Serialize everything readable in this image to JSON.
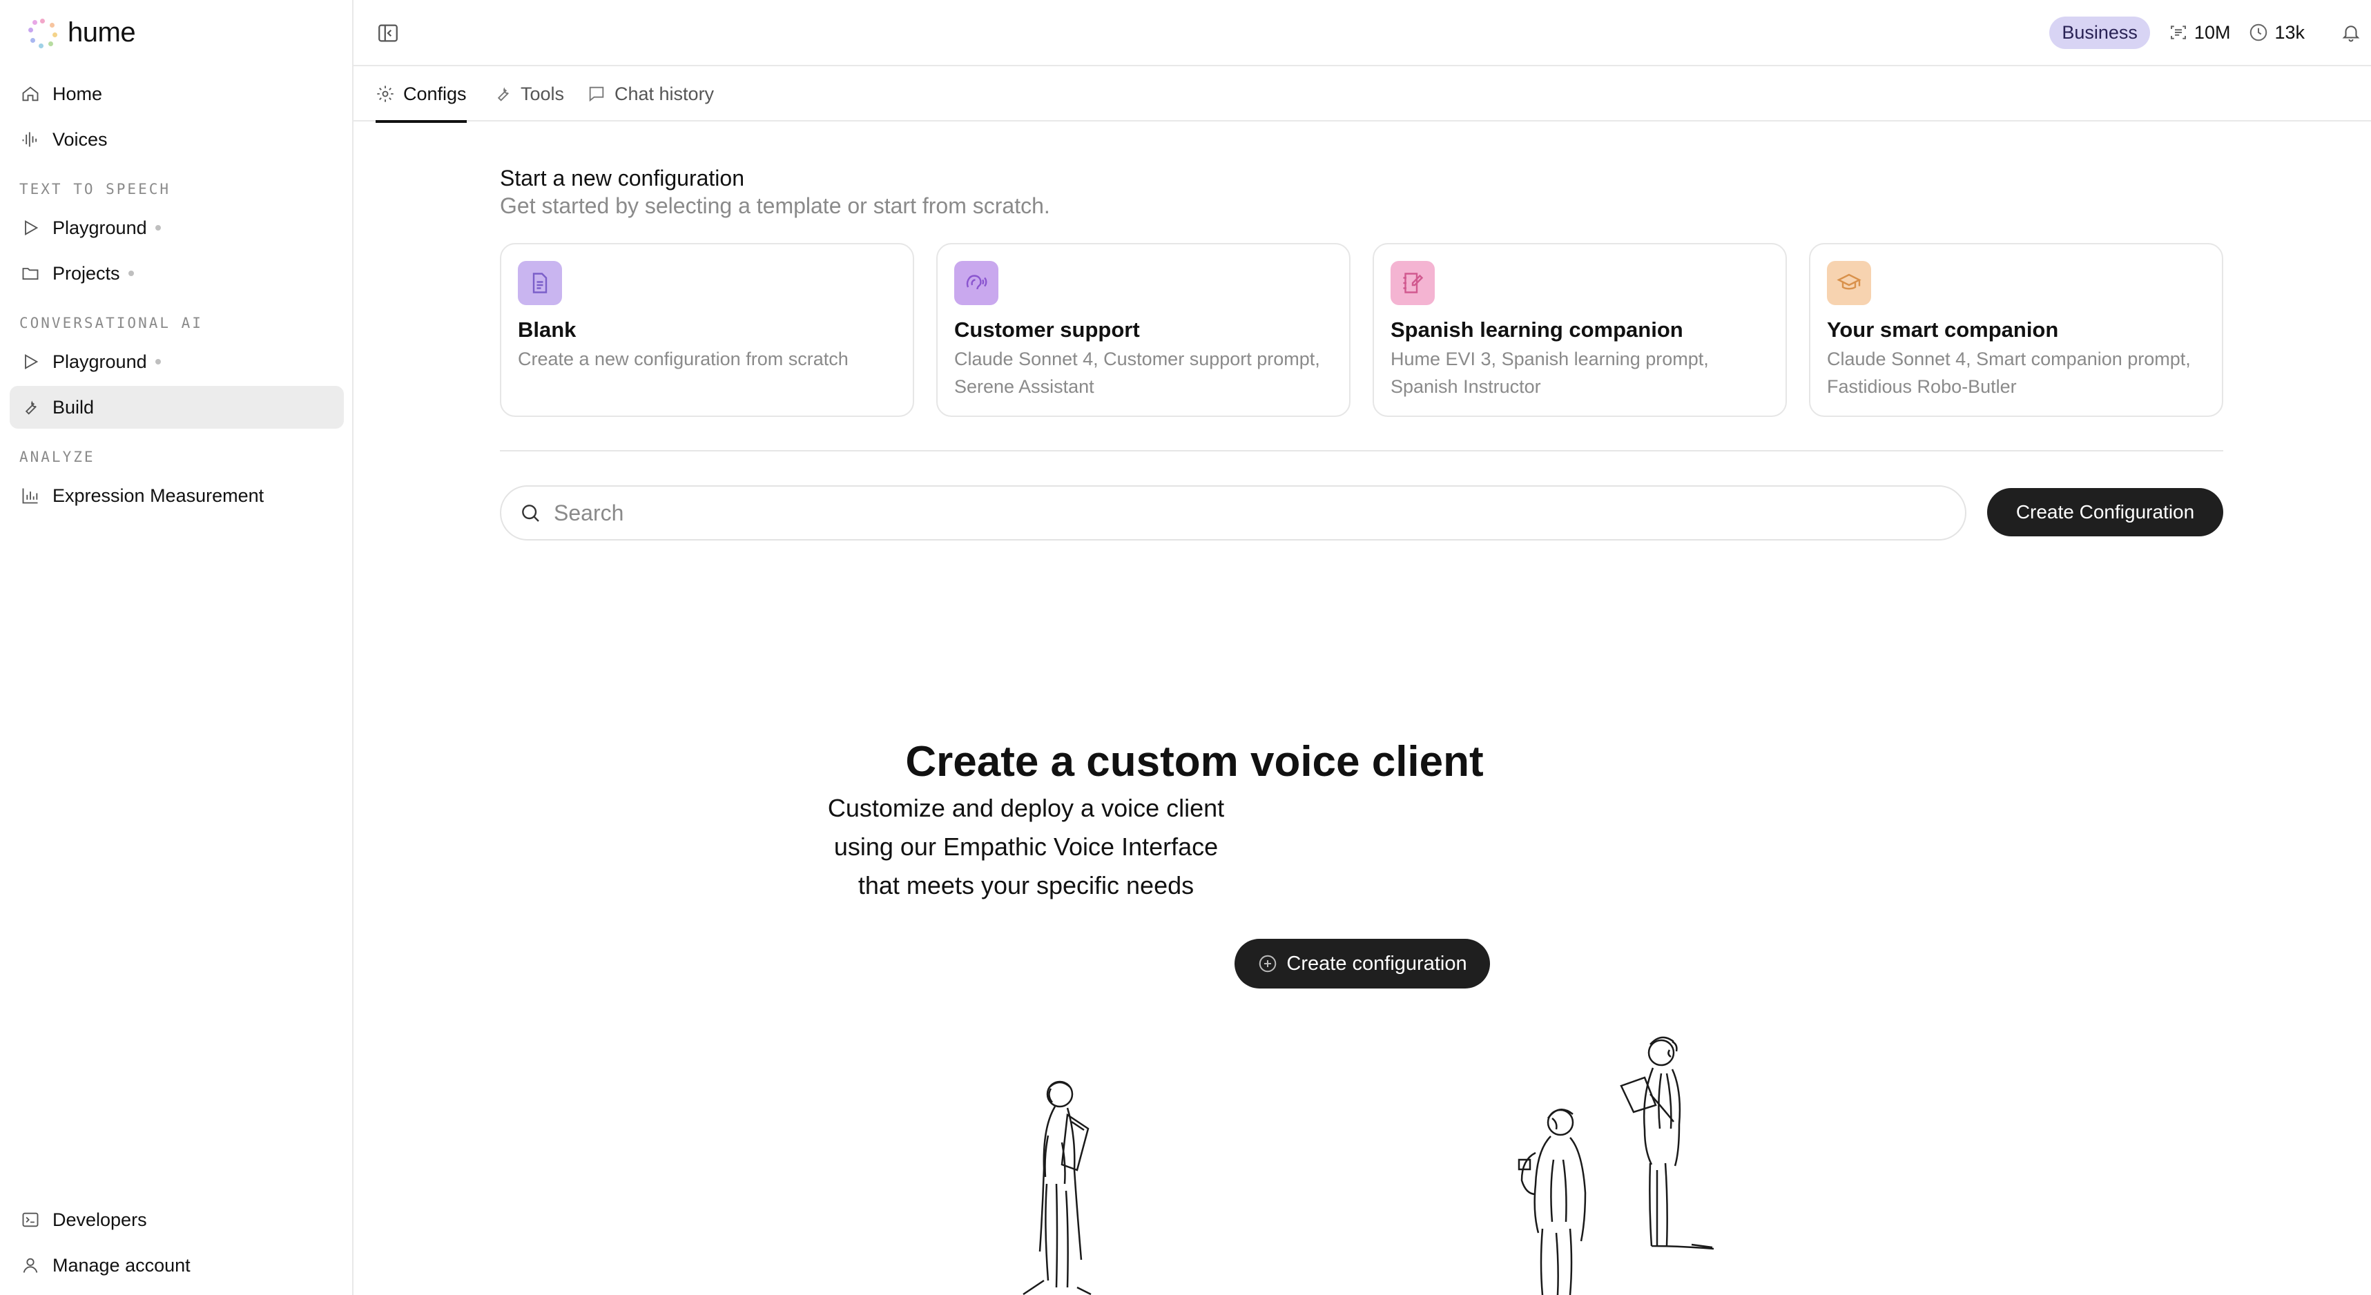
{
  "brand": {
    "name": "hume"
  },
  "sidebar": {
    "items_top": [
      {
        "label": "Home",
        "icon": "home-icon"
      },
      {
        "label": "Voices",
        "icon": "waveform-icon"
      }
    ],
    "sections": [
      {
        "label": "TEXT TO SPEECH"
      },
      {
        "label": "CONVERSATIONAL AI"
      },
      {
        "label": "ANALYZE"
      }
    ],
    "tts_items": [
      {
        "label": "Playground",
        "icon": "play-icon"
      },
      {
        "label": "Projects",
        "icon": "folder-icon"
      }
    ],
    "conv_items": [
      {
        "label": "Playground",
        "icon": "play-icon"
      },
      {
        "label": "Build",
        "icon": "wrench-icon",
        "active": true
      }
    ],
    "analyze_items": [
      {
        "label": "Expression Measurement",
        "icon": "bar-chart-icon"
      }
    ],
    "bottom_items": [
      {
        "label": "Developers",
        "icon": "terminal-icon"
      },
      {
        "label": "Manage account",
        "icon": "user-icon"
      }
    ]
  },
  "topbar": {
    "plan": "Business",
    "characters": "10M",
    "minutes": "13k"
  },
  "tabs": [
    {
      "label": "Configs",
      "icon": "gear-icon",
      "active": true
    },
    {
      "label": "Tools",
      "icon": "wrench-icon"
    },
    {
      "label": "Chat history",
      "icon": "chat-icon"
    }
  ],
  "main": {
    "title": "Start a new configuration",
    "subtitle": "Get started by selecting a template or start from scratch.",
    "templates": [
      {
        "title": "Blank",
        "description": "Create a new configuration from scratch",
        "icon": "document-icon",
        "color": "#c9b5f0",
        "icon_color": "#7b5fc9"
      },
      {
        "title": "Customer support",
        "description": "Claude Sonnet 4, Customer support prompt, Serene Assistant",
        "icon": "headset-voice-icon",
        "color": "#c9a8ee",
        "icon_color": "#8a55cf"
      },
      {
        "title": "Spanish learning companion",
        "description": "Hume EVI 3, Spanish learning prompt, Spanish Instructor",
        "icon": "notebook-pen-icon",
        "color": "#f4b4d2",
        "icon_color": "#d1598f"
      },
      {
        "title": "Your smart companion",
        "description": "Claude Sonnet 4, Smart companion prompt, Fastidious Robo-Butler",
        "icon": "graduation-cap-icon",
        "color": "#f7d3b0",
        "icon_color": "#d9914b"
      }
    ],
    "search_placeholder": "Search",
    "create_button": "Create Configuration",
    "hero": {
      "title": "Create a custom voice client",
      "lines": [
        "Customize and deploy a voice client",
        "using our Empathic Voice Interface",
        "that meets your specific needs"
      ],
      "button": "Create configuration"
    }
  }
}
